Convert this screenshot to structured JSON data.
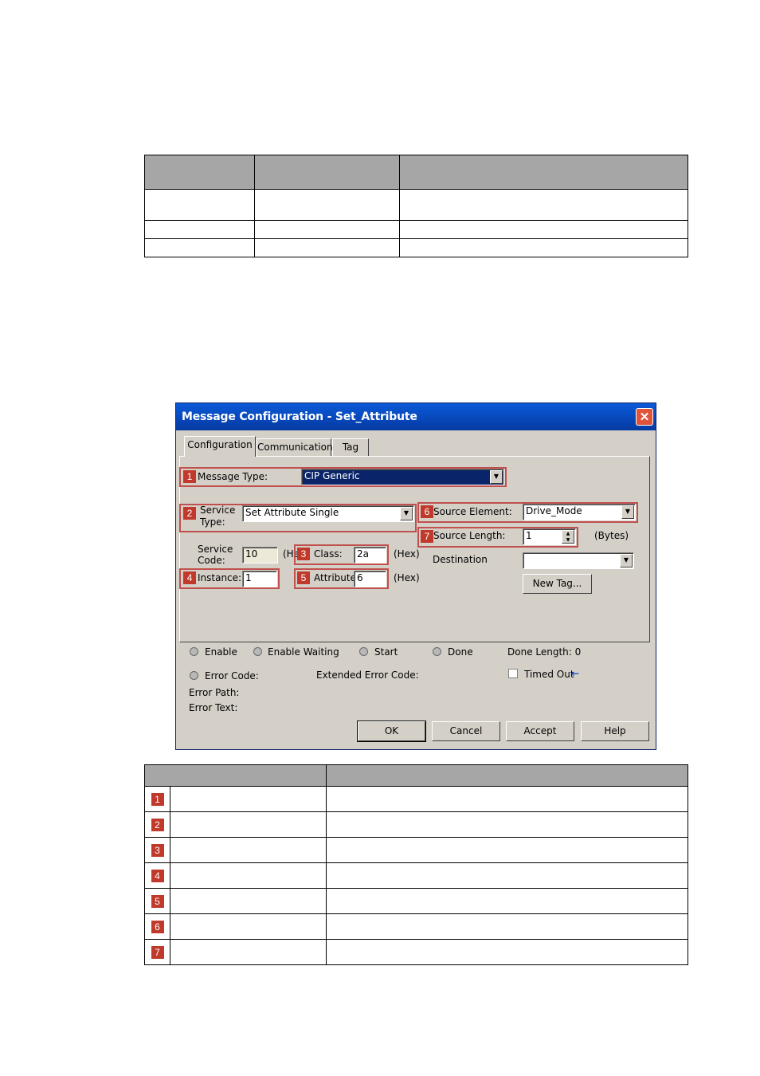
{
  "dialog": {
    "title": "Message Configuration - Set_Attribute",
    "close_glyph": "✕",
    "tabs": [
      "Configuration",
      "Communication",
      "Tag"
    ],
    "message_type_label": "Message Type:",
    "message_type_value": "CIP Generic",
    "service_type_label_1": "Service",
    "service_type_label_2": "Type:",
    "service_type_value": "Set Attribute Single",
    "service_code_label_1": "Service",
    "service_code_label_2": "Code:",
    "service_code_value": "10",
    "service_code_unit": "(He",
    "class_label": "Class:",
    "class_value": "2a",
    "class_unit": "(Hex)",
    "instance_label": "Instance:",
    "instance_value": "1",
    "attribute_label": "Attribute:",
    "attribute_value": "6",
    "attribute_unit": "(Hex)",
    "source_element_label": "Source Element:",
    "source_element_value": "Drive_Mode",
    "source_length_label": "Source Length:",
    "source_length_value": "1",
    "source_length_unit": "(Bytes)",
    "destination_label": "Destination",
    "destination_value": "",
    "new_tag_label": "New Tag...",
    "status": {
      "enable": "Enable",
      "enable_waiting": "Enable Waiting",
      "start": "Start",
      "done": "Done",
      "done_length": "Done Length: 0",
      "error_code": "Error Code:",
      "extended_error_code": "Extended Error Code:",
      "timed_out": "Timed Out",
      "timed_out_arrow": "←",
      "error_path": "Error Path:",
      "error_text": "Error Text:"
    },
    "buttons": {
      "ok": "OK",
      "cancel": "Cancel",
      "accept": "Accept",
      "help": "Help"
    }
  },
  "badges": [
    "1",
    "2",
    "3",
    "4",
    "5",
    "6",
    "7"
  ],
  "colors": {
    "badge": "#c0392b",
    "highlight_box": "#c0504d",
    "table_header": "#a6a6a6",
    "title_bar": "#0a5bd8"
  }
}
